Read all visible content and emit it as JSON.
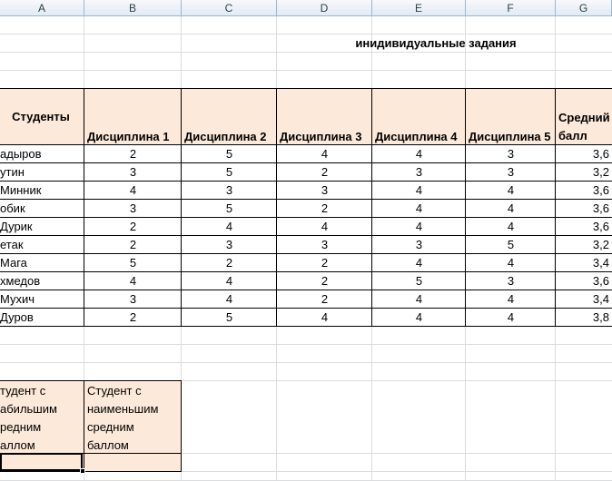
{
  "columns": [
    "A",
    "B",
    "C",
    "D",
    "E",
    "F",
    "G"
  ],
  "title": "инидивидуальные задания",
  "table": {
    "students_header": "Студенты",
    "discipline_headers": [
      "Дисциплина 1",
      "Дисциплина 2",
      "Дисциплина 3",
      "Дисциплина 4",
      "Дисциплина 5"
    ],
    "avg_header_line1": "Средний",
    "avg_header_line2": "балл",
    "rows": [
      {
        "name": "адыров",
        "scores": [
          "2",
          "5",
          "4",
          "4",
          "3"
        ],
        "avg": "3,6"
      },
      {
        "name": "утин",
        "scores": [
          "3",
          "5",
          "2",
          "3",
          "3"
        ],
        "avg": "3,2"
      },
      {
        "name": "Минник",
        "scores": [
          "4",
          "3",
          "3",
          "4",
          "4"
        ],
        "avg": "3,6"
      },
      {
        "name": "обик",
        "scores": [
          "3",
          "5",
          "2",
          "4",
          "4"
        ],
        "avg": "3,6"
      },
      {
        "name": "Дурик",
        "scores": [
          "2",
          "4",
          "4",
          "4",
          "4"
        ],
        "avg": "3,6"
      },
      {
        "name": "етак",
        "scores": [
          "2",
          "3",
          "3",
          "3",
          "5"
        ],
        "avg": "3,2"
      },
      {
        "name": "Мага",
        "scores": [
          "5",
          "2",
          "2",
          "4",
          "4"
        ],
        "avg": "3,4"
      },
      {
        "name": "хмедов",
        "scores": [
          "4",
          "4",
          "2",
          "5",
          "3"
        ],
        "avg": "3,6"
      },
      {
        "name": "Мухич",
        "scores": [
          "3",
          "4",
          "2",
          "4",
          "4"
        ],
        "avg": "3,4"
      },
      {
        "name": "Дуров",
        "scores": [
          "2",
          "5",
          "4",
          "4",
          "4"
        ],
        "avg": "3,8"
      }
    ]
  },
  "summary": {
    "max_lines": [
      "тудент с",
      "абильшим",
      "редним",
      "аллом"
    ],
    "min_lines": [
      "Студент с",
      "наименьшим",
      "средним",
      "баллом"
    ],
    "max_value": "",
    "min_value": ""
  }
}
